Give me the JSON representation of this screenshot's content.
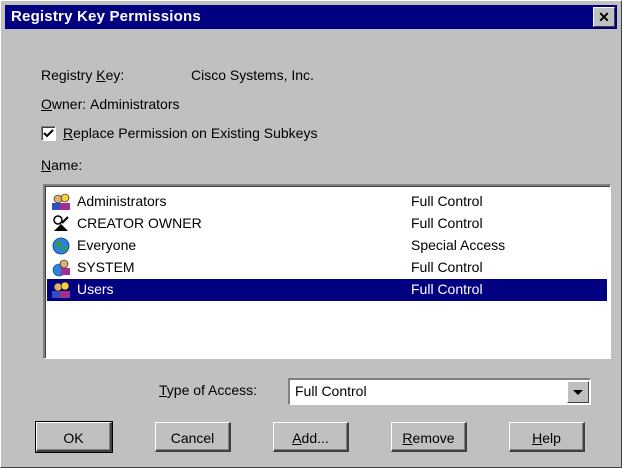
{
  "dialog": {
    "title": "Registry Key Permissions",
    "close_label": "✕"
  },
  "registry_key": {
    "label_pre": "Registry ",
    "label_ul": "K",
    "label_post": "ey:",
    "value": "Cisco Systems, Inc."
  },
  "owner": {
    "label_ul": "O",
    "label_post": "wner:",
    "value": "Administrators"
  },
  "replace_checkbox": {
    "checked": true,
    "label_ul": "R",
    "label_post": "eplace Permission on Existing Subkeys"
  },
  "name_label": {
    "label_ul": "N",
    "label_post": "ame:"
  },
  "permissions": [
    {
      "name": "Administrators",
      "access": "Full Control",
      "icon": "group-icon",
      "selected": false
    },
    {
      "name": "CREATOR OWNER",
      "access": "Full Control",
      "icon": "creator-owner-icon",
      "selected": false
    },
    {
      "name": "Everyone",
      "access": "Special Access",
      "icon": "globe-icon",
      "selected": false
    },
    {
      "name": "SYSTEM",
      "access": "Full Control",
      "icon": "system-group-icon",
      "selected": false
    },
    {
      "name": "Users",
      "access": "Full Control",
      "icon": "group-icon",
      "selected": true
    }
  ],
  "type_of_access": {
    "label_ul": "T",
    "label_post": "ype of Access:",
    "selected": "Full Control"
  },
  "buttons": {
    "ok": "OK",
    "cancel": "Cancel",
    "add_ul": "A",
    "add_post": "dd...",
    "remove_ul": "R",
    "remove_post": "emove",
    "help_ul": "H",
    "help_post": "elp"
  },
  "colors": {
    "title_bar": "#000080",
    "selection": "#000080",
    "face": "#c0c0c0"
  }
}
